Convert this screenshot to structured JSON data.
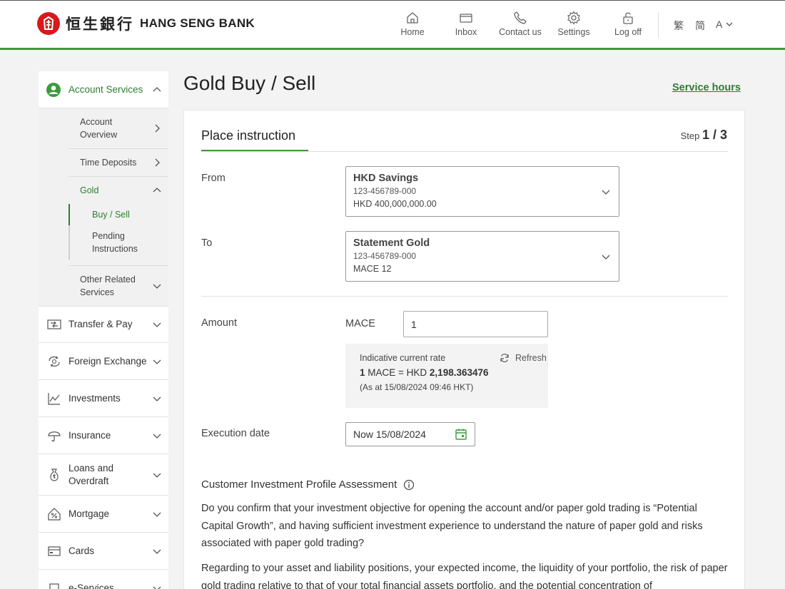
{
  "header": {
    "logo_cn": "恒生銀行",
    "logo_en": "HANG SENG BANK",
    "nav": [
      {
        "label": "Home",
        "icon": "home-icon"
      },
      {
        "label": "Inbox",
        "icon": "inbox-icon"
      },
      {
        "label": "Contact us",
        "icon": "phone-icon"
      },
      {
        "label": "Settings",
        "icon": "gear-icon"
      },
      {
        "label": "Log off",
        "icon": "lock-icon"
      }
    ],
    "lang_trad": "繁",
    "lang_simp": "简",
    "font_size": "A"
  },
  "sidebar": {
    "account_services": "Account Services",
    "sub": {
      "account_overview": "Account Overview",
      "time_deposits": "Time Deposits",
      "gold": "Gold",
      "buy_sell": "Buy / Sell",
      "pending": "Pending Instructions",
      "other": "Other Related Services"
    },
    "items": [
      {
        "label": "Transfer & Pay",
        "icon": "transfer-icon"
      },
      {
        "label": "Foreign Exchange",
        "icon": "fx-icon"
      },
      {
        "label": "Investments",
        "icon": "chart-icon"
      },
      {
        "label": "Insurance",
        "icon": "umbrella-icon"
      },
      {
        "label": "Loans and Overdraft",
        "icon": "money-bag-icon"
      },
      {
        "label": "Mortgage",
        "icon": "house-percent-icon"
      },
      {
        "label": "Cards",
        "icon": "card-icon"
      },
      {
        "label": "e-Services",
        "icon": "laptop-icon"
      }
    ],
    "accent": "#2e7d32"
  },
  "main": {
    "title": "Gold Buy / Sell",
    "service_hours": "Service hours",
    "tab_title": "Place instruction",
    "step_label": "Step",
    "step_value": "1 / 3",
    "from_label": "From",
    "from": {
      "name": "HKD Savings",
      "number": "123-456789-000",
      "balance": "HKD 400,000,000.00"
    },
    "to_label": "To",
    "to": {
      "name": "Statement Gold",
      "number": "123-456789-000",
      "balance": "MACE 12"
    },
    "amount_label": "Amount",
    "amount_unit": "MACE",
    "amount_value": "1",
    "rate": {
      "title": "Indicative current rate",
      "prefix": "1",
      "middle": " MACE = HKD ",
      "value": "2,198.363476",
      "asof": "(As at 15/08/2024 09:46 HKT)"
    },
    "refresh": "Refresh",
    "exec_label": "Execution date",
    "exec_value": "Now 15/08/2024",
    "cipa_title": "Customer Investment Profile Assessment",
    "para1": "Do you confirm that your investment objective for opening the account and/or paper gold trading is “Potential Capital Growth”, and having sufficient investment experience to understand the nature of paper gold and risks associated with paper gold trading?",
    "para2": "Regarding to your asset and liability positions, your expected income, the liquidity of your portfolio, the risk of paper gold trading relative to that of your total financial assets portfolio, and the potential concentration of"
  }
}
